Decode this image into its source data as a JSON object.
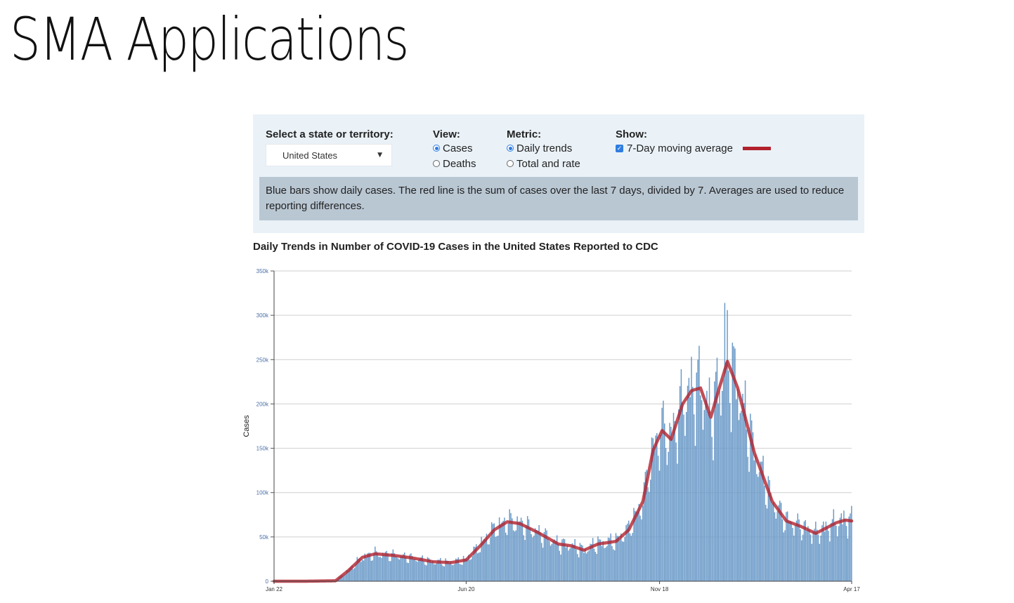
{
  "slide": {
    "title": "SMA Applications"
  },
  "controls": {
    "state_label": "Select a state or territory:",
    "state_value": "United States",
    "view_label": "View:",
    "view_options": [
      {
        "label": "Cases",
        "checked": true
      },
      {
        "label": "Deaths",
        "checked": false
      }
    ],
    "metric_label": "Metric:",
    "metric_options": [
      {
        "label": "Daily trends",
        "checked": true
      },
      {
        "label": "Total and rate",
        "checked": false
      }
    ],
    "show_label": "Show:",
    "show_option": {
      "label": "7-Day moving average",
      "checked": true
    },
    "info_text": "Blue bars show daily cases. The red line is the sum of cases over the last 7 days, divided by 7. Averages are used to reduce reporting differences."
  },
  "colors": {
    "bar": "#6b9ac8",
    "avg_line": "#b2222d",
    "panel_bg": "#eaf2f8",
    "info_bg": "#b9c7d3",
    "accent": "#2f7de1"
  },
  "chart_data": {
    "type": "bar",
    "title": "Daily Trends in Number of COVID-19 Cases in the United States Reported to CDC",
    "xlabel": "",
    "ylabel": "Cases",
    "ylim": [
      0,
      350000
    ],
    "y_ticks": [
      {
        "value": 0,
        "label": "0"
      },
      {
        "value": 50000,
        "label": "50k"
      },
      {
        "value": 100000,
        "label": "100k"
      },
      {
        "value": 150000,
        "label": "150k"
      },
      {
        "value": 200000,
        "label": "200k"
      },
      {
        "value": 250000,
        "label": "250k"
      },
      {
        "value": 300000,
        "label": "300k"
      },
      {
        "value": 350000,
        "label": "350k"
      }
    ],
    "x_ticks": [
      {
        "date": "2020-01-22",
        "label": "Jan 22"
      },
      {
        "date": "2020-06-20",
        "label": "Jun 20"
      },
      {
        "date": "2020-11-18",
        "label": "Nov 18"
      },
      {
        "date": "2021-04-17",
        "label": "Apr 17"
      }
    ],
    "grid": true,
    "series": [
      {
        "name": "7-Day moving average",
        "kind": "line",
        "points": [
          [
            "2020-01-22",
            0
          ],
          [
            "2020-02-15",
            0
          ],
          [
            "2020-03-10",
            500
          ],
          [
            "2020-03-20",
            12000
          ],
          [
            "2020-03-31",
            27000
          ],
          [
            "2020-04-10",
            31000
          ],
          [
            "2020-04-25",
            29000
          ],
          [
            "2020-05-10",
            26000
          ],
          [
            "2020-05-25",
            22000
          ],
          [
            "2020-06-08",
            21000
          ],
          [
            "2020-06-20",
            24000
          ],
          [
            "2020-07-01",
            40000
          ],
          [
            "2020-07-12",
            58000
          ],
          [
            "2020-07-22",
            67000
          ],
          [
            "2020-08-01",
            65000
          ],
          [
            "2020-08-15",
            55000
          ],
          [
            "2020-08-31",
            42000
          ],
          [
            "2020-09-10",
            40000
          ],
          [
            "2020-09-20",
            35000
          ],
          [
            "2020-10-01",
            42000
          ],
          [
            "2020-10-15",
            45000
          ],
          [
            "2020-10-25",
            58000
          ],
          [
            "2020-11-05",
            90000
          ],
          [
            "2020-11-13",
            148000
          ],
          [
            "2020-11-20",
            170000
          ],
          [
            "2020-11-27",
            160000
          ],
          [
            "2020-12-06",
            200000
          ],
          [
            "2020-12-13",
            215000
          ],
          [
            "2020-12-20",
            218000
          ],
          [
            "2020-12-28",
            185000
          ],
          [
            "2021-01-03",
            215000
          ],
          [
            "2021-01-10",
            248000
          ],
          [
            "2021-01-18",
            218000
          ],
          [
            "2021-01-31",
            145000
          ],
          [
            "2021-02-14",
            90000
          ],
          [
            "2021-02-25",
            68000
          ],
          [
            "2021-03-08",
            62000
          ],
          [
            "2021-03-20",
            54000
          ],
          [
            "2021-03-28",
            60000
          ],
          [
            "2021-04-05",
            66000
          ],
          [
            "2021-04-12",
            69000
          ],
          [
            "2021-04-17",
            68000
          ]
        ]
      }
    ],
    "bar_envelope": {
      "note": "Daily bars follow the moving average with weekly reporting variation",
      "peak": {
        "date": "2021-01-08",
        "value": 314000
      }
    }
  }
}
